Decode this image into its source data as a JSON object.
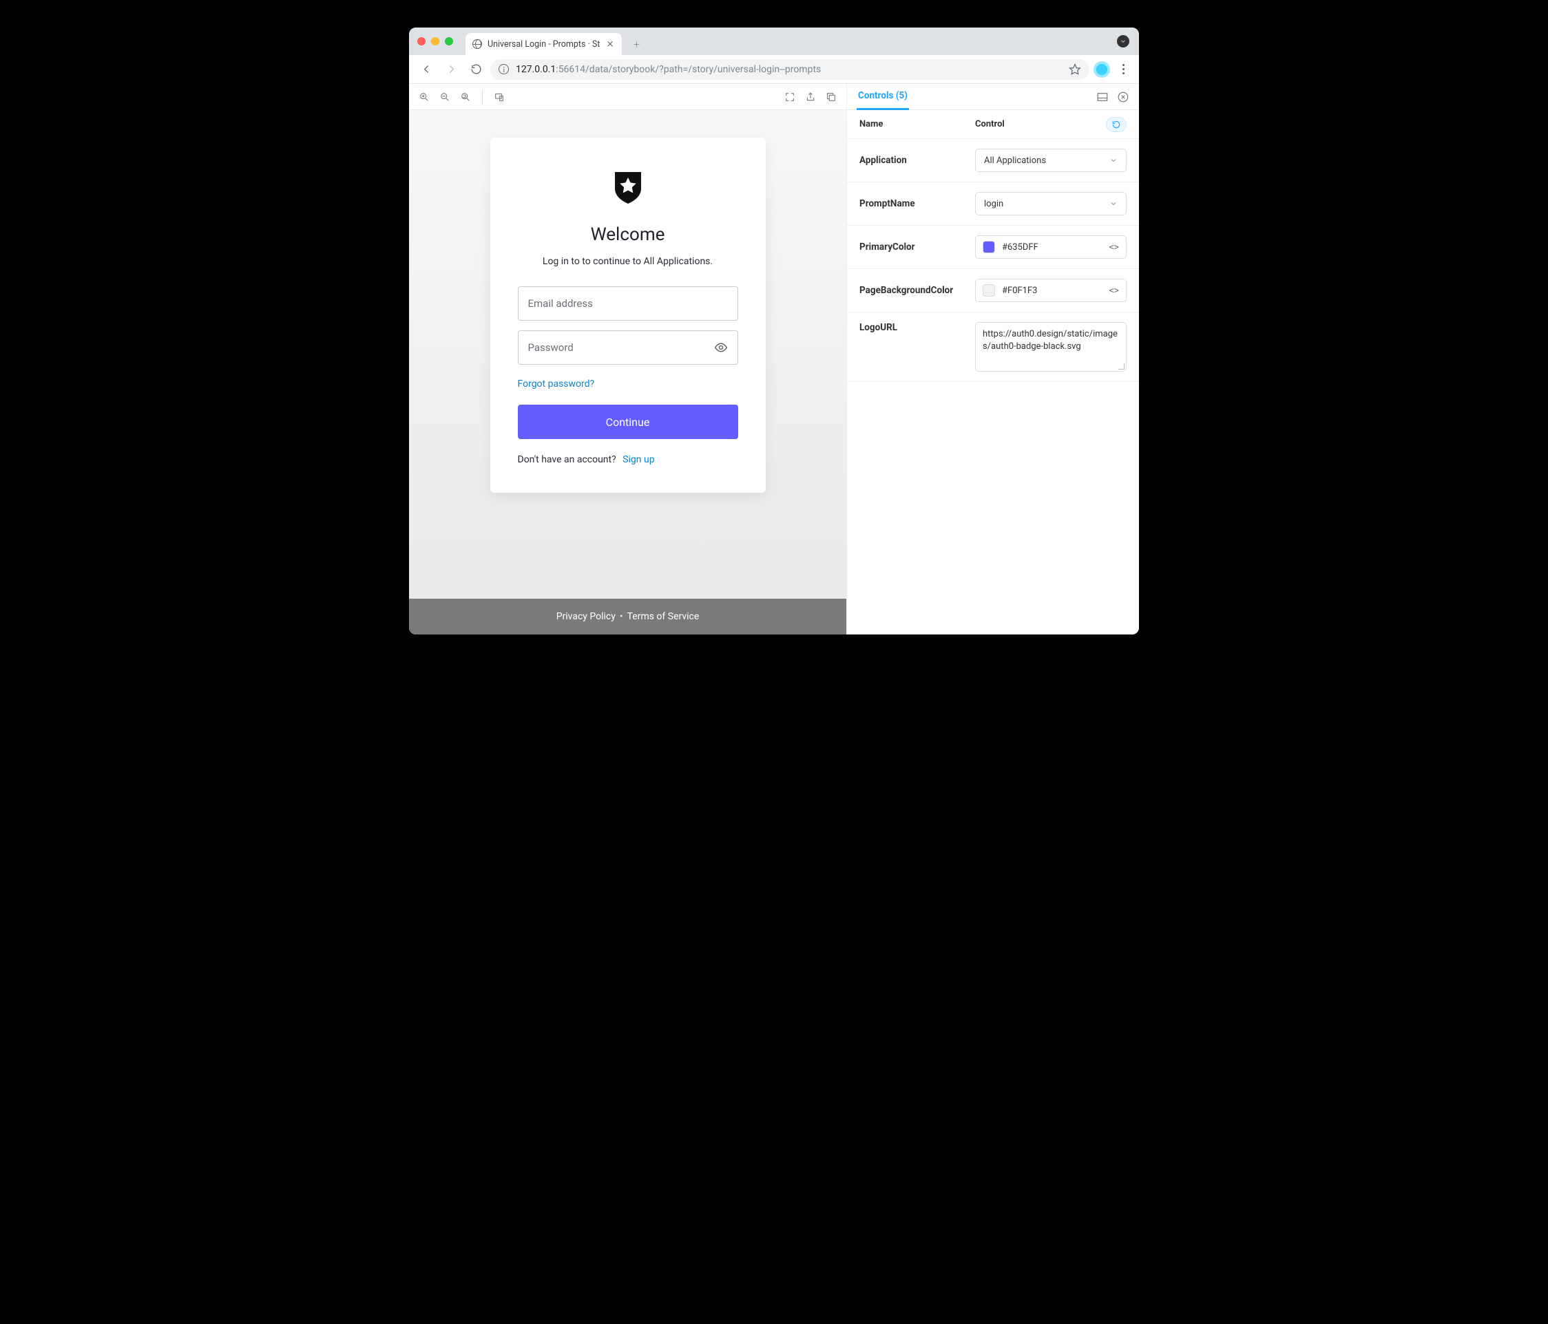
{
  "browser": {
    "tab_title": "Universal Login - Prompts · St",
    "url_host": "127.0.0.1",
    "url_port": ":56614",
    "url_path": "/data/storybook/?path=/story/universal-login--prompts"
  },
  "controls_panel": {
    "tab_label": "Controls (5)",
    "header_name": "Name",
    "header_control": "Control",
    "rows": {
      "application": {
        "label": "Application",
        "value": "All Applications"
      },
      "prompt_name": {
        "label": "PromptName",
        "value": "login"
      },
      "primary_color": {
        "label": "PrimaryColor",
        "value": "#635DFF",
        "swatch": "#635DFF"
      },
      "page_bg": {
        "label": "PageBackgroundColor",
        "value": "#F0F1F3",
        "swatch": "#F0F1F3"
      },
      "logo_url": {
        "label": "LogoURL",
        "value": "https://auth0.design/static/images/auth0-badge-black.svg"
      }
    },
    "code_toggle": "<>"
  },
  "login": {
    "title": "Welcome",
    "subtitle": "Log in to to continue to All Applications.",
    "email_placeholder": "Email address",
    "password_placeholder": "Password",
    "forgot": "Forgot password?",
    "continue": "Continue",
    "no_account": "Don't have an account?",
    "signup": "Sign up"
  },
  "footer": {
    "privacy": "Privacy Policy",
    "terms": "Terms of Service"
  }
}
